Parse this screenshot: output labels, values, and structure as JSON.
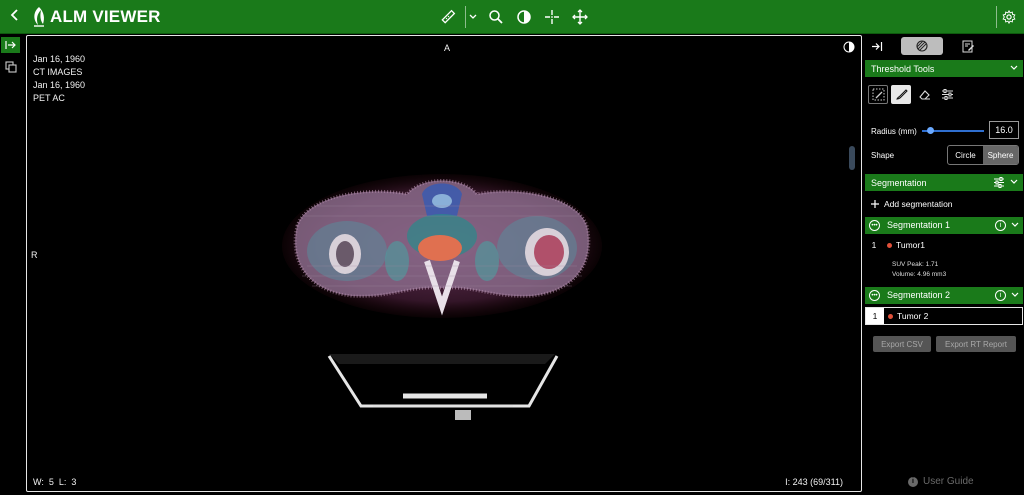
{
  "app": {
    "title": "ALM VIEWER"
  },
  "toolbar": {
    "icons": [
      "chevron-left-icon",
      "ruler-icon",
      "chevron-down-icon",
      "zoom-icon",
      "contrast-icon",
      "crosshair-icon",
      "pan-icon",
      "gear-icon"
    ]
  },
  "viewport": {
    "overlay_top_left": [
      "Jan 16, 1960",
      "CT IMAGES",
      "Jan 16, 1960",
      "PET AC"
    ],
    "orientation_top": "A",
    "orientation_left": "R",
    "window": "W:  5  L:  3",
    "instance": "I: 243 (69/311)"
  },
  "panel": {
    "threshold_tools": {
      "title": "Threshold Tools"
    },
    "radius": {
      "label": "Radius (mm)",
      "value": "16.0",
      "level_fraction": 0.13
    },
    "shape": {
      "label": "Shape",
      "options": [
        "Circle",
        "Sphere"
      ],
      "selected": "Sphere"
    },
    "segmentation": {
      "title": "Segmentation",
      "add_label": "Add segmentation",
      "groups": [
        {
          "name": "Segmentation 1",
          "items": [
            {
              "index": "1",
              "label": "Tumor1",
              "suv_peak": "SUV Peak: 1.71",
              "volume": "Volume: 4.96 mm3"
            }
          ]
        },
        {
          "name": "Segmentation 2",
          "items": [
            {
              "index": "1",
              "label": "Tumor 2"
            }
          ]
        }
      ]
    },
    "export_csv": "Export CSV",
    "export_rt": "Export RT Report",
    "user_guide": "User Guide"
  },
  "colors": {
    "accent": "#1a7a1a",
    "tumor_dot": "#e0503a",
    "slider": "#2f6fd0"
  }
}
